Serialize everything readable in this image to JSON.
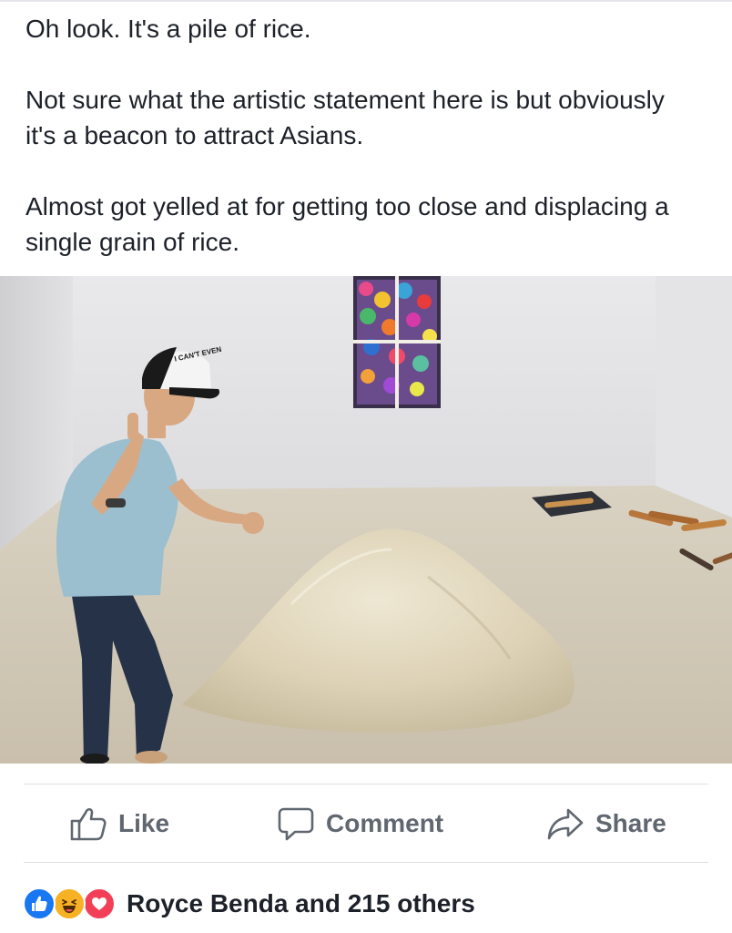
{
  "post": {
    "paragraphs": [
      "Oh look. It's a pile of rice.",
      "Not sure what the artistic statement here is but obviously it's a beacon to attract Asians.",
      "Almost got yelled at for getting too close and displacing a single grain of rice."
    ],
    "photo": {
      "icon": "photo-gallery-pile-of-rice",
      "cap_text": "I CAN'T EVEN"
    }
  },
  "actions": {
    "like_label": "Like",
    "comment_label": "Comment",
    "share_label": "Share"
  },
  "reactions": {
    "icons": [
      "like-reaction-icon",
      "haha-reaction-icon",
      "love-reaction-icon"
    ],
    "summary": "Royce Benda and 215 others"
  },
  "colors": {
    "like_blue": "#1877f2",
    "haha_yellow": "#f7b125",
    "love_red": "#f33e58",
    "action_gray": "#606770"
  }
}
